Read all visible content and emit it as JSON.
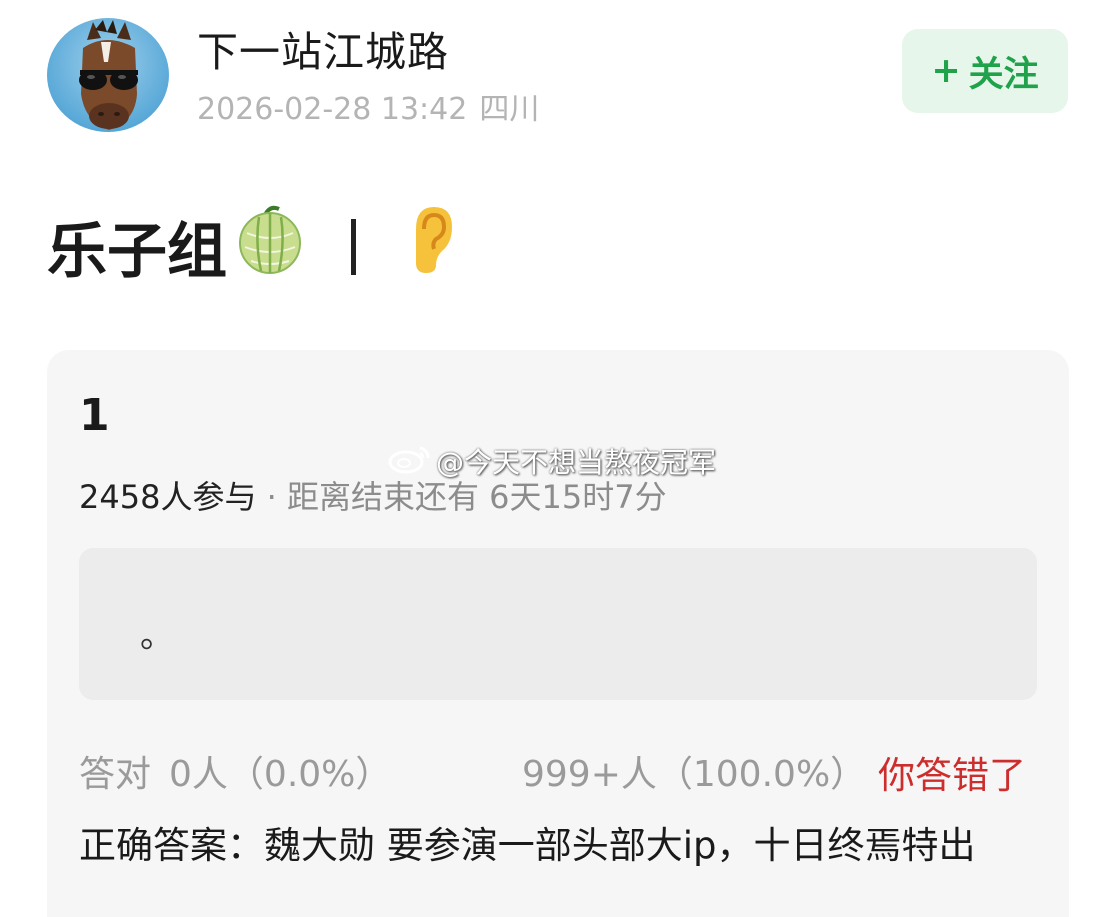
{
  "header": {
    "username": "下一站江城路",
    "datetime": "2026-02-28 13:42",
    "location": "四川",
    "follow": {
      "plus": "+",
      "label": "关注"
    }
  },
  "post": {
    "title": "乐子组",
    "title_emoji_1": "melon",
    "title_emoji_2": "ear"
  },
  "quiz": {
    "number": "1",
    "participants": "2458人参与",
    "separator": " · ",
    "remaining": "距离结束还有 6天15时7分",
    "option_text": "。",
    "correct_label": "答对",
    "correct_count": "0人（0.0%）",
    "wrong_count": "999+人（100.0%）",
    "wrong_status": "你答错了",
    "answer_text": "正确答案：魏大勋 要参演一部头部大ip，十日终焉特出"
  },
  "watermark": {
    "text": "@今天不想当熬夜冠军"
  },
  "colors": {
    "follow_bg": "#e6f6ea",
    "follow_text": "#1fa24a",
    "wrong_text": "#cc2e2e",
    "card_bg": "#f6f6f6",
    "option_bg": "#ececec"
  }
}
